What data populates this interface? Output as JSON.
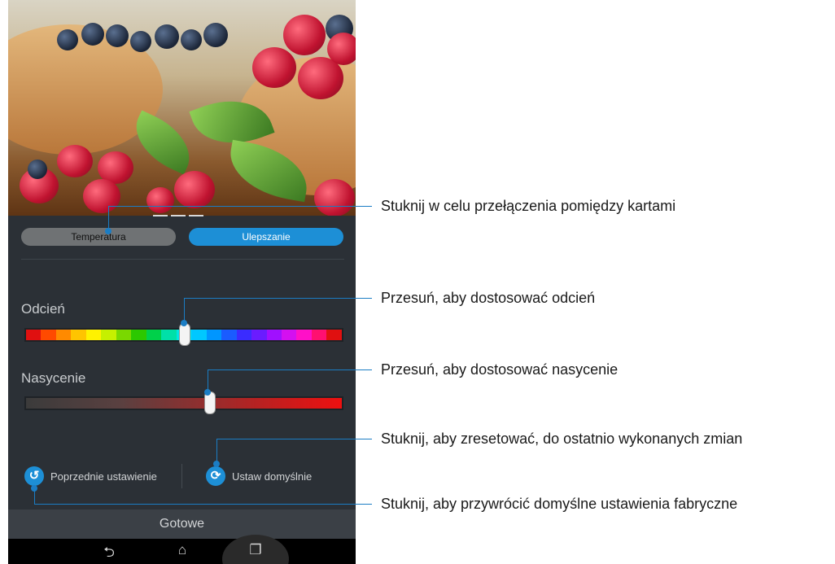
{
  "tabs": {
    "temperature": "Temperatura",
    "enhancement": "Ulepszanie"
  },
  "sliders": {
    "hue_label": "Odcień",
    "saturation_label": "Nasycenie",
    "hue_value_fraction": 0.5,
    "saturation_value_fraction": 0.58
  },
  "actions": {
    "previous_label": "Poprzednie ustawienie",
    "default_label": "Ustaw domyślnie"
  },
  "done_label": "Gotowe",
  "callouts": {
    "tabs": "Stuknij w celu przełączenia pomiędzy kartami",
    "hue": "Przesuń, aby dostosować odcień",
    "saturation": "Przesuń, aby dostosować nasycenie",
    "previous": "Stuknij, aby zresetować, do ostatnio wykonanych zmian",
    "default": "Stuknij, aby przywrócić domyślne ustawienia fabryczne"
  },
  "colors": {
    "accent": "#1d8fd6",
    "callout_line": "#1b7dc4",
    "panel_bg": "#2b3036",
    "hue_segments": [
      "#e01010",
      "#ff4a00",
      "#ff8a00",
      "#ffc400",
      "#fff200",
      "#c6f000",
      "#7ad800",
      "#2cc800",
      "#00d04a",
      "#00e0a8",
      "#00e6e6",
      "#00c8ff",
      "#0096ff",
      "#1a5cff",
      "#3a2cff",
      "#6a1cff",
      "#a010ff",
      "#d410f0",
      "#ff10c8",
      "#ff1070",
      "#e01010"
    ]
  },
  "icons": {
    "previous": "undo-icon",
    "default": "refresh-icon",
    "nav_back": "back-icon",
    "nav_home": "home-icon",
    "nav_recent": "recent-apps-icon"
  }
}
